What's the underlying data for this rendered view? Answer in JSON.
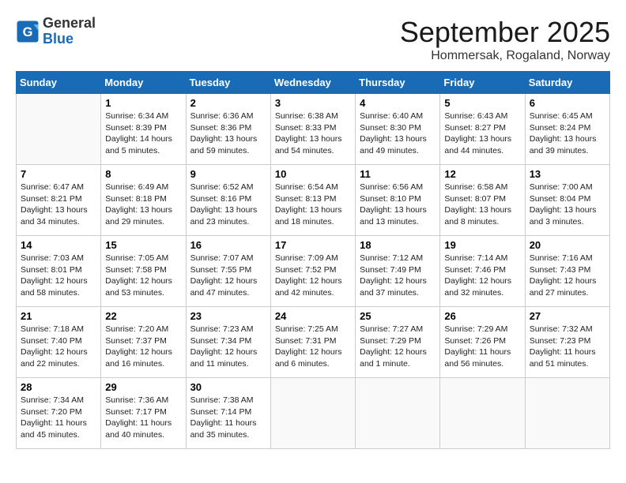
{
  "header": {
    "logo_line1": "General",
    "logo_line2": "Blue",
    "month": "September 2025",
    "location": "Hommersak, Rogaland, Norway"
  },
  "weekdays": [
    "Sunday",
    "Monday",
    "Tuesday",
    "Wednesday",
    "Thursday",
    "Friday",
    "Saturday"
  ],
  "weeks": [
    [
      {
        "day": "",
        "info": ""
      },
      {
        "day": "1",
        "info": "Sunrise: 6:34 AM\nSunset: 8:39 PM\nDaylight: 14 hours\nand 5 minutes."
      },
      {
        "day": "2",
        "info": "Sunrise: 6:36 AM\nSunset: 8:36 PM\nDaylight: 13 hours\nand 59 minutes."
      },
      {
        "day": "3",
        "info": "Sunrise: 6:38 AM\nSunset: 8:33 PM\nDaylight: 13 hours\nand 54 minutes."
      },
      {
        "day": "4",
        "info": "Sunrise: 6:40 AM\nSunset: 8:30 PM\nDaylight: 13 hours\nand 49 minutes."
      },
      {
        "day": "5",
        "info": "Sunrise: 6:43 AM\nSunset: 8:27 PM\nDaylight: 13 hours\nand 44 minutes."
      },
      {
        "day": "6",
        "info": "Sunrise: 6:45 AM\nSunset: 8:24 PM\nDaylight: 13 hours\nand 39 minutes."
      }
    ],
    [
      {
        "day": "7",
        "info": "Sunrise: 6:47 AM\nSunset: 8:21 PM\nDaylight: 13 hours\nand 34 minutes."
      },
      {
        "day": "8",
        "info": "Sunrise: 6:49 AM\nSunset: 8:18 PM\nDaylight: 13 hours\nand 29 minutes."
      },
      {
        "day": "9",
        "info": "Sunrise: 6:52 AM\nSunset: 8:16 PM\nDaylight: 13 hours\nand 23 minutes."
      },
      {
        "day": "10",
        "info": "Sunrise: 6:54 AM\nSunset: 8:13 PM\nDaylight: 13 hours\nand 18 minutes."
      },
      {
        "day": "11",
        "info": "Sunrise: 6:56 AM\nSunset: 8:10 PM\nDaylight: 13 hours\nand 13 minutes."
      },
      {
        "day": "12",
        "info": "Sunrise: 6:58 AM\nSunset: 8:07 PM\nDaylight: 13 hours\nand 8 minutes."
      },
      {
        "day": "13",
        "info": "Sunrise: 7:00 AM\nSunset: 8:04 PM\nDaylight: 13 hours\nand 3 minutes."
      }
    ],
    [
      {
        "day": "14",
        "info": "Sunrise: 7:03 AM\nSunset: 8:01 PM\nDaylight: 12 hours\nand 58 minutes."
      },
      {
        "day": "15",
        "info": "Sunrise: 7:05 AM\nSunset: 7:58 PM\nDaylight: 12 hours\nand 53 minutes."
      },
      {
        "day": "16",
        "info": "Sunrise: 7:07 AM\nSunset: 7:55 PM\nDaylight: 12 hours\nand 47 minutes."
      },
      {
        "day": "17",
        "info": "Sunrise: 7:09 AM\nSunset: 7:52 PM\nDaylight: 12 hours\nand 42 minutes."
      },
      {
        "day": "18",
        "info": "Sunrise: 7:12 AM\nSunset: 7:49 PM\nDaylight: 12 hours\nand 37 minutes."
      },
      {
        "day": "19",
        "info": "Sunrise: 7:14 AM\nSunset: 7:46 PM\nDaylight: 12 hours\nand 32 minutes."
      },
      {
        "day": "20",
        "info": "Sunrise: 7:16 AM\nSunset: 7:43 PM\nDaylight: 12 hours\nand 27 minutes."
      }
    ],
    [
      {
        "day": "21",
        "info": "Sunrise: 7:18 AM\nSunset: 7:40 PM\nDaylight: 12 hours\nand 22 minutes."
      },
      {
        "day": "22",
        "info": "Sunrise: 7:20 AM\nSunset: 7:37 PM\nDaylight: 12 hours\nand 16 minutes."
      },
      {
        "day": "23",
        "info": "Sunrise: 7:23 AM\nSunset: 7:34 PM\nDaylight: 12 hours\nand 11 minutes."
      },
      {
        "day": "24",
        "info": "Sunrise: 7:25 AM\nSunset: 7:31 PM\nDaylight: 12 hours\nand 6 minutes."
      },
      {
        "day": "25",
        "info": "Sunrise: 7:27 AM\nSunset: 7:29 PM\nDaylight: 12 hours\nand 1 minute."
      },
      {
        "day": "26",
        "info": "Sunrise: 7:29 AM\nSunset: 7:26 PM\nDaylight: 11 hours\nand 56 minutes."
      },
      {
        "day": "27",
        "info": "Sunrise: 7:32 AM\nSunset: 7:23 PM\nDaylight: 11 hours\nand 51 minutes."
      }
    ],
    [
      {
        "day": "28",
        "info": "Sunrise: 7:34 AM\nSunset: 7:20 PM\nDaylight: 11 hours\nand 45 minutes."
      },
      {
        "day": "29",
        "info": "Sunrise: 7:36 AM\nSunset: 7:17 PM\nDaylight: 11 hours\nand 40 minutes."
      },
      {
        "day": "30",
        "info": "Sunrise: 7:38 AM\nSunset: 7:14 PM\nDaylight: 11 hours\nand 35 minutes."
      },
      {
        "day": "",
        "info": ""
      },
      {
        "day": "",
        "info": ""
      },
      {
        "day": "",
        "info": ""
      },
      {
        "day": "",
        "info": ""
      }
    ]
  ]
}
